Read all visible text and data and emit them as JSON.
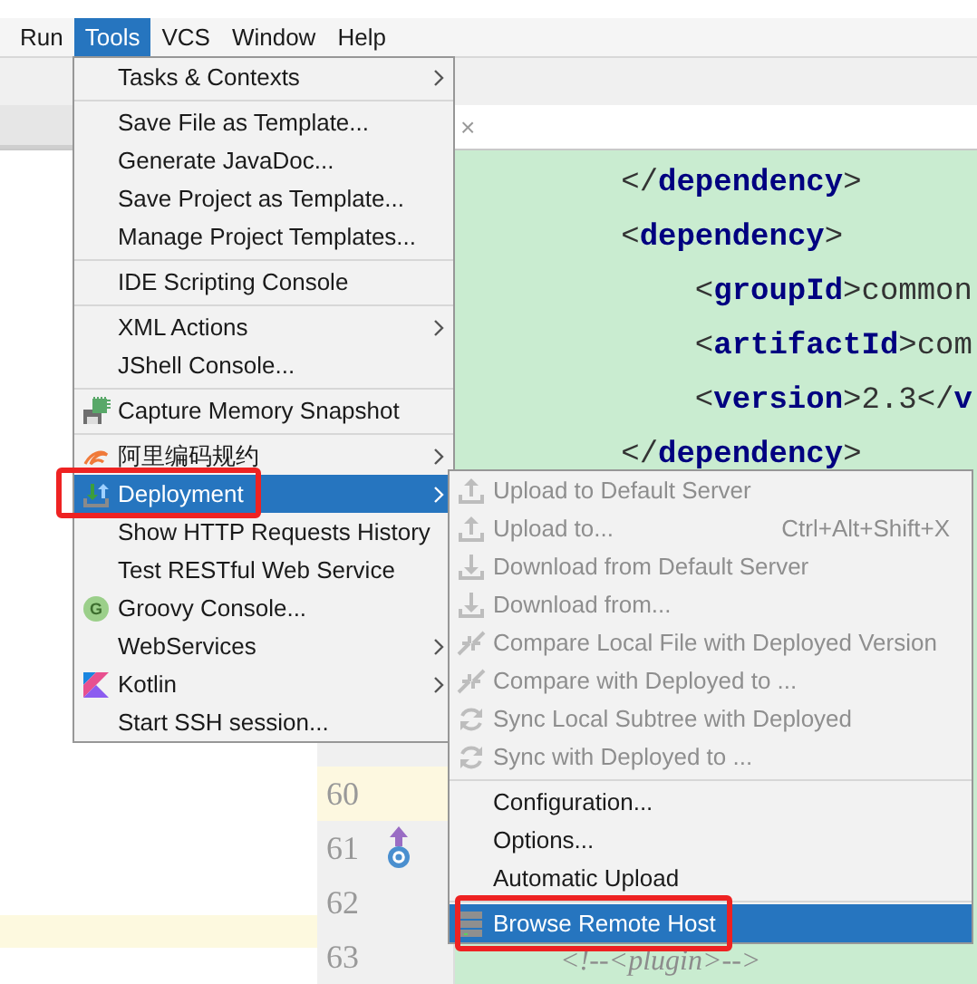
{
  "menubar": [
    {
      "label": "Run",
      "selected": false
    },
    {
      "label": "Tools",
      "selected": true
    },
    {
      "label": "VCS",
      "selected": false
    },
    {
      "label": "Window",
      "selected": false
    },
    {
      "label": "Help",
      "selected": false
    }
  ],
  "tab": {
    "close": "×"
  },
  "editor": {
    "top_lines": [
      "        </**dependency**>",
      "        <**dependency**>",
      "            <**groupId**>common",
      "            <**artifactId**>com",
      "            <**version**>2.3</**v**",
      "        </**dependency**>"
    ],
    "bottom_rows": [
      {
        "number": "60",
        "current": true,
        "marker": false
      },
      {
        "number": "61",
        "current": false,
        "marker": true
      },
      {
        "number": "62",
        "current": false,
        "marker": false
      },
      {
        "number": "63",
        "current": false,
        "marker": false,
        "code": "            <!--<plugin>-->"
      }
    ]
  },
  "tools_menu": [
    {
      "kind": "item",
      "label": "Tasks & Contexts",
      "submenu": true,
      "selected": false,
      "framed": false
    },
    {
      "kind": "separator"
    },
    {
      "kind": "item",
      "label": "Save File as Template...",
      "submenu": false,
      "selected": false,
      "framed": false
    },
    {
      "kind": "item",
      "label": "Generate JavaDoc...",
      "submenu": false,
      "selected": false,
      "framed": false
    },
    {
      "kind": "item",
      "label": "Save Project as Template...",
      "submenu": false,
      "selected": false,
      "framed": false
    },
    {
      "kind": "item",
      "label": "Manage Project Templates...",
      "submenu": false,
      "selected": false,
      "framed": false
    },
    {
      "kind": "separator"
    },
    {
      "kind": "item",
      "label": "IDE Scripting Console",
      "submenu": false,
      "selected": false,
      "framed": false
    },
    {
      "kind": "separator"
    },
    {
      "kind": "item",
      "label": "XML Actions",
      "submenu": true,
      "selected": false,
      "framed": false
    },
    {
      "kind": "item",
      "label": "JShell Console...",
      "submenu": false,
      "selected": false,
      "framed": false
    },
    {
      "kind": "separator"
    },
    {
      "kind": "item",
      "label": "Capture Memory Snapshot",
      "submenu": false,
      "selected": false,
      "framed": false
    },
    {
      "kind": "separator"
    },
    {
      "kind": "item",
      "label": "阿里编码规约",
      "submenu": true,
      "selected": false,
      "framed": false
    },
    {
      "kind": "item",
      "label": "Deployment",
      "submenu": true,
      "selected": true,
      "framed": true
    },
    {
      "kind": "item",
      "label": "Show HTTP Requests History",
      "submenu": false,
      "selected": false,
      "framed": false
    },
    {
      "kind": "item",
      "label": "Test RESTful Web Service",
      "submenu": false,
      "selected": false,
      "framed": false
    },
    {
      "kind": "item",
      "label": "Groovy Console...",
      "submenu": false,
      "selected": false,
      "framed": false,
      "icon_text": "G"
    },
    {
      "kind": "item",
      "label": "WebServices",
      "submenu": true,
      "selected": false,
      "framed": false
    },
    {
      "kind": "item",
      "label": "Kotlin",
      "submenu": true,
      "selected": false,
      "framed": false
    },
    {
      "kind": "item",
      "label": "Start SSH session...",
      "submenu": false,
      "selected": false,
      "framed": false
    }
  ],
  "deployment_menu": [
    {
      "kind": "item",
      "label": "Upload to Default Server",
      "disabled": true,
      "selected": false,
      "framed": false
    },
    {
      "kind": "item",
      "label": "Upload to...",
      "shortcut": "Ctrl+Alt+Shift+X",
      "disabled": true,
      "selected": false,
      "framed": false
    },
    {
      "kind": "item",
      "label": "Download from Default Server",
      "disabled": true,
      "selected": false,
      "framed": false
    },
    {
      "kind": "item",
      "label": "Download from...",
      "disabled": true,
      "selected": false,
      "framed": false
    },
    {
      "kind": "item",
      "label": "Compare Local File with Deployed Version",
      "disabled": true,
      "selected": false,
      "framed": false
    },
    {
      "kind": "item",
      "label": "Compare with Deployed to ...",
      "disabled": true,
      "selected": false,
      "framed": false
    },
    {
      "kind": "item",
      "label": "Sync Local Subtree with Deployed",
      "disabled": true,
      "selected": false,
      "framed": false
    },
    {
      "kind": "item",
      "label": "Sync with Deployed to ...",
      "disabled": true,
      "selected": false,
      "framed": false
    },
    {
      "kind": "separator"
    },
    {
      "kind": "item",
      "label": "Configuration...",
      "disabled": false,
      "selected": false,
      "framed": false
    },
    {
      "kind": "item",
      "label": "Options...",
      "disabled": false,
      "selected": false,
      "framed": false
    },
    {
      "kind": "item",
      "label": "Automatic Upload",
      "disabled": false,
      "selected": false,
      "framed": false
    },
    {
      "kind": "separator"
    },
    {
      "kind": "item",
      "label": "Browse Remote Host",
      "disabled": false,
      "selected": true,
      "framed": true
    }
  ]
}
